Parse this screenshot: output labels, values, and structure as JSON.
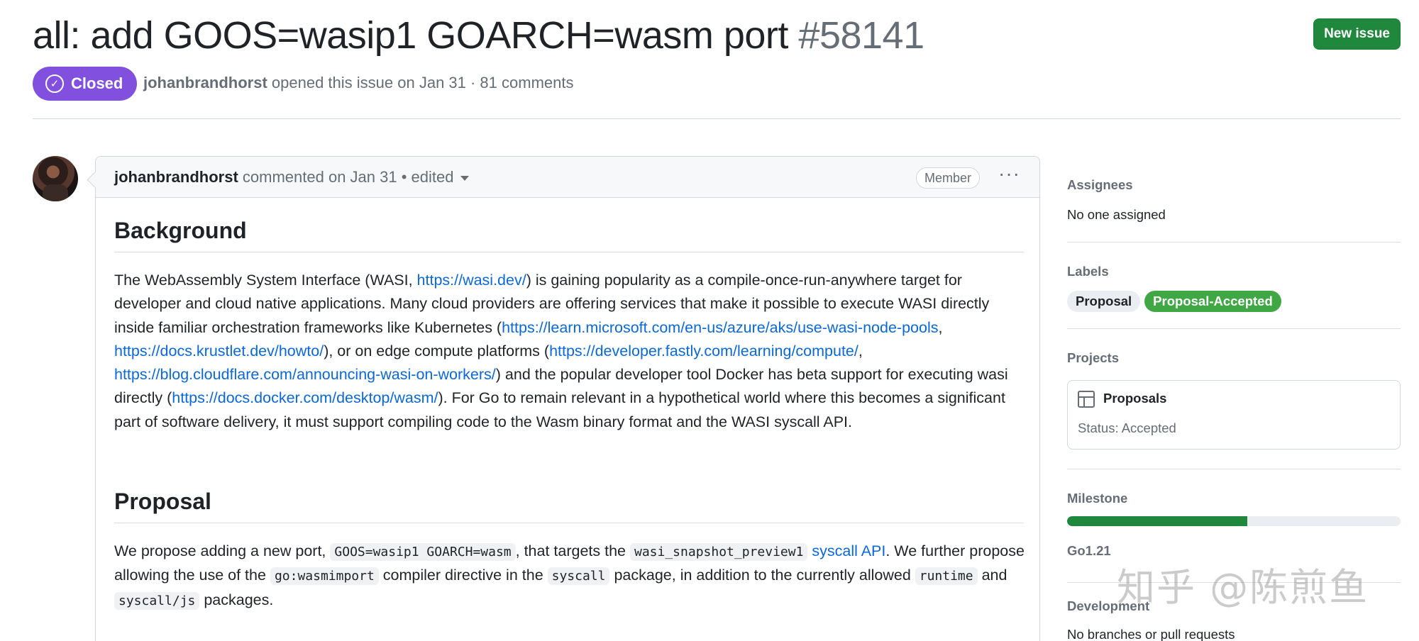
{
  "issue": {
    "title": "all: add GOOS=wasip1 GOARCH=wasm port",
    "number": "#58141",
    "state": "Closed",
    "author": "johanbrandhorst",
    "meta_suffix": "opened this issue on Jan 31 · 81 comments",
    "new_issue_label": "New issue"
  },
  "comment": {
    "author": "johanbrandhorst",
    "action": "commented on Jan 31 • edited",
    "badge": "Member",
    "menu": "···",
    "h_background": "Background",
    "bg_1": "The WebAssembly System Interface (WASI, ",
    "link_wasi": "https://wasi.dev/",
    "bg_2": ") is gaining popularity as a compile-once-run-anywhere target for developer and cloud native applications. Many cloud providers are offering services that make it possible to execute WASI directly inside familiar orchestration frameworks like Kubernetes (",
    "link_ms": "https://learn.microsoft.com/en-us/azure/aks/use-wasi-node-pools",
    "bg_3": ", ",
    "link_krustlet": "https://docs.krustlet.dev/howto/",
    "bg_4": "), or on edge compute platforms (",
    "link_fastly": "https://developer.fastly.com/learning/compute/",
    "bg_5": ", ",
    "link_cloudflare": "https://blog.cloudflare.com/announcing-wasi-on-workers/",
    "bg_6": ") and the popular developer tool Docker has beta support for executing wasi directly (",
    "link_docker": "https://docs.docker.com/desktop/wasm/",
    "bg_7": "). For Go to remain relevant in a hypothetical world where this becomes a significant part of software delivery, it must support compiling code to the Wasm binary format and the WASI syscall API.",
    "h_proposal": "Proposal",
    "pr_1": "We propose adding a new port, ",
    "code_port": "GOOS=wasip1 GOARCH=wasm",
    "pr_2": ", that targets the ",
    "code_preview": "wasi_snapshot_preview1",
    "pr_3": " ",
    "link_syscall": "syscall API",
    "pr_4": ". We further propose allowing the use of the ",
    "code_directive": "go:wasmimport",
    "pr_5": " compiler directive in the ",
    "code_syscall": "syscall",
    "pr_6": " package, in addition to the currently allowed ",
    "code_runtime": "runtime",
    "pr_7": " and ",
    "code_js": "syscall/js",
    "pr_8": " packages."
  },
  "sidebar": {
    "assignees_title": "Assignees",
    "assignees_value": "No one assigned",
    "labels_title": "Labels",
    "labels": [
      {
        "name": "Proposal",
        "color": "#eaeef2"
      },
      {
        "name": "Proposal-Accepted",
        "color": "#3fa844"
      }
    ],
    "projects_title": "Projects",
    "project_name": "Proposals",
    "project_status": "Status: Accepted",
    "milestone_title": "Milestone",
    "milestone_progress": 0.54,
    "milestone_name": "Go1.21",
    "development_title": "Development",
    "development_value": "No branches or pull requests"
  },
  "watermark": "知乎 @陈煎鱼",
  "colors": {
    "closed": "#8250df",
    "new_issue": "#1f883d",
    "link": "#0969da",
    "label_accepted": "#3fa844"
  }
}
